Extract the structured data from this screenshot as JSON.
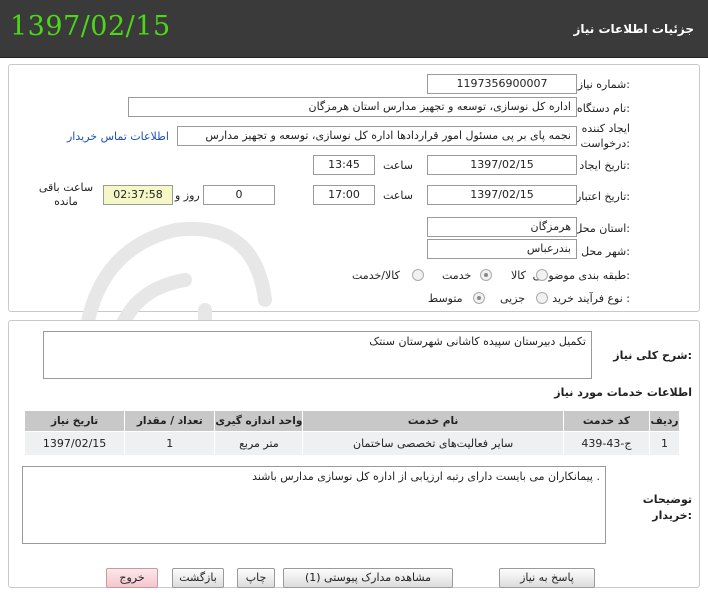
{
  "header": {
    "date": "1397/02/15",
    "title": "جزئیات اطلاعات نیاز"
  },
  "info": {
    "need_number_label": "شماره نیاز:",
    "need_number": "1197356900007",
    "buyer_org_label": "نام دستگاه خریدار:",
    "buyer_org": "اداره کل نوسازی، توسعه و تجهیز مدارس استان هرمزگان",
    "requester_label_1": "ایجاد کننده",
    "requester_label_2": "درخواست:",
    "requester": "نجمه  پای بر پی مسئول امور قراردادها اداره کل نوسازی، توسعه و تجهیز مدارس",
    "buyer_contact_link": "اطلاعات تماس خریدار",
    "created_label": "تاریخ ایجاد نیاز:",
    "created_date": "1397/02/15",
    "time_label": "ساعت",
    "created_time": "13:45",
    "validity_label": "تاریخ اعتبار نیاز:",
    "validity_date": "1397/02/15",
    "validity_time": "17:00",
    "days_value": "0",
    "days_label": "روز و",
    "remaining_time": "02:37:58",
    "remaining_label": "ساعت باقی مانده",
    "province_label": "استان محل تحویل:",
    "province": "هرمزگان",
    "city_label": "شهر محل تحویل:",
    "city": "بندرعباس",
    "category_label": "طبقه بندی موضوعی:",
    "category_options": [
      "کالا",
      "خدمت",
      "کالا/خدمت"
    ],
    "process_label": "نوع فرآیند خرید :",
    "process_options": [
      "جزیی",
      "متوسط"
    ]
  },
  "description": {
    "label": "شرح کلی نیاز:",
    "text": "تکمیل دبیرستان سپیده کاشانی شهرستان سنتک"
  },
  "services": {
    "title": "اطلاعات خدمات مورد نیاز",
    "columns": [
      "ردیف",
      "کد خدمت",
      "نام خدمت",
      "واحد اندازه گیری",
      "تعداد / مقدار",
      "تاریخ نیاز"
    ],
    "rows": [
      [
        "1",
        "ج-43-439",
        "سایر فعالیت‌های تخصصی ساختمان",
        "متر مربع",
        "1",
        "1397/02/15"
      ]
    ]
  },
  "buyer_notes": {
    "label_1": "توضیحات",
    "label_2": "خریدار:",
    "text": "پیمانکاران می بایست دارای رتبه ارزیابی از اداره کل نوسازی مدارس باشند ."
  },
  "buttons": {
    "reply": "پاسخ به نیاز",
    "view_docs": "مشاهده مدارک پیوستی (1)",
    "print": "چاپ",
    "back": "بازگشت",
    "exit": "خروج"
  },
  "colors": {
    "header_bg": "#3a3a3a",
    "header_date": "#4cd817",
    "table_head": "#c8c8c8"
  }
}
